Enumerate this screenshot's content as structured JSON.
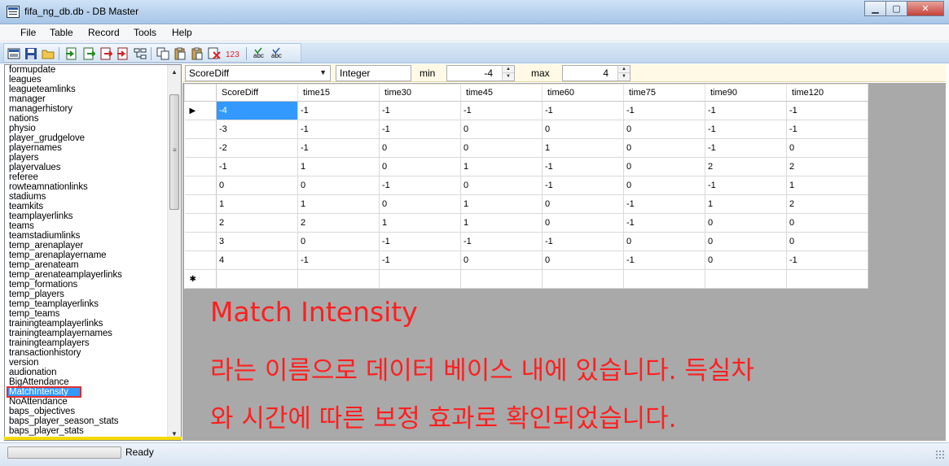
{
  "window": {
    "title": "fifa_ng_db.db - DB Master"
  },
  "menu": [
    "File",
    "Table",
    "Record",
    "Tools",
    "Help"
  ],
  "toolbar_icons": [
    "open-db-icon",
    "save-icon",
    "open-folder-icon",
    "import-icon",
    "export-icon",
    "export-red-icon",
    "import-red-icon",
    "tree-icon",
    "copy-icon",
    "paste-icon",
    "paste-special-icon",
    "delete-icon",
    "number-format-icon",
    "spellcheck-icon",
    "spellcheck-alt-icon"
  ],
  "tables": [
    "formupdate",
    "leagues",
    "leagueteamlinks",
    "manager",
    "managerhistory",
    "nations",
    "physio",
    "player_grudgelove",
    "playernames",
    "players",
    "playervalues",
    "referee",
    "rowteamnationlinks",
    "stadiums",
    "teamkits",
    "teamplayerlinks",
    "teams",
    "teamstadiumlinks",
    "temp_arenaplayer",
    "temp_arenaplayername",
    "temp_arenateam",
    "temp_arenateamplayerlinks",
    "temp_formations",
    "temp_players",
    "temp_teamplayerlinks",
    "temp_teams",
    "trainingteamplayerlinks",
    "trainingteamplayernames",
    "trainingteamplayers",
    "transactionhistory",
    "version",
    "audionation",
    "BigAttendance",
    "MatchIntensity",
    "NoAttendance",
    "baps_objectives",
    "baps_player_season_stats",
    "baps_player_stats"
  ],
  "selected_table": "MatchIntensity",
  "filter": {
    "field": "ScoreDiff",
    "type": "Integer",
    "min_label": "min",
    "min": "-4",
    "max_label": "max",
    "max": "4"
  },
  "grid": {
    "columns": [
      "ScoreDiff",
      "time15",
      "time30",
      "time45",
      "time60",
      "time75",
      "time90",
      "time120"
    ],
    "rows": [
      [
        "-4",
        "-1",
        "-1",
        "-1",
        "-1",
        "-1",
        "-1",
        "-1"
      ],
      [
        "-3",
        "-1",
        "-1",
        "0",
        "0",
        "0",
        "-1",
        "-1"
      ],
      [
        "-2",
        "-1",
        "0",
        "0",
        "1",
        "0",
        "-1",
        "0"
      ],
      [
        "-1",
        "1",
        "0",
        "1",
        "-1",
        "0",
        "2",
        "2"
      ],
      [
        "0",
        "0",
        "-1",
        "0",
        "-1",
        "0",
        "-1",
        "1"
      ],
      [
        "1",
        "1",
        "0",
        "1",
        "0",
        "-1",
        "1",
        "2"
      ],
      [
        "2",
        "2",
        "1",
        "1",
        "0",
        "-1",
        "0",
        "0"
      ],
      [
        "3",
        "0",
        "-1",
        "-1",
        "-1",
        "0",
        "0",
        "0"
      ],
      [
        "4",
        "-1",
        "-1",
        "0",
        "0",
        "-1",
        "0",
        "-1"
      ]
    ],
    "current_marker": "▶",
    "new_row_marker": "✱"
  },
  "annotation": {
    "line1": "Match Intensity",
    "line2": "라는 이름으로 데이터 베이스 내에 있습니다. 득실차",
    "line3": "와 시간에 따른 보정 효과로 확인되었습니다.",
    "color": "#ff1f1f"
  },
  "status": {
    "text": "Ready"
  }
}
